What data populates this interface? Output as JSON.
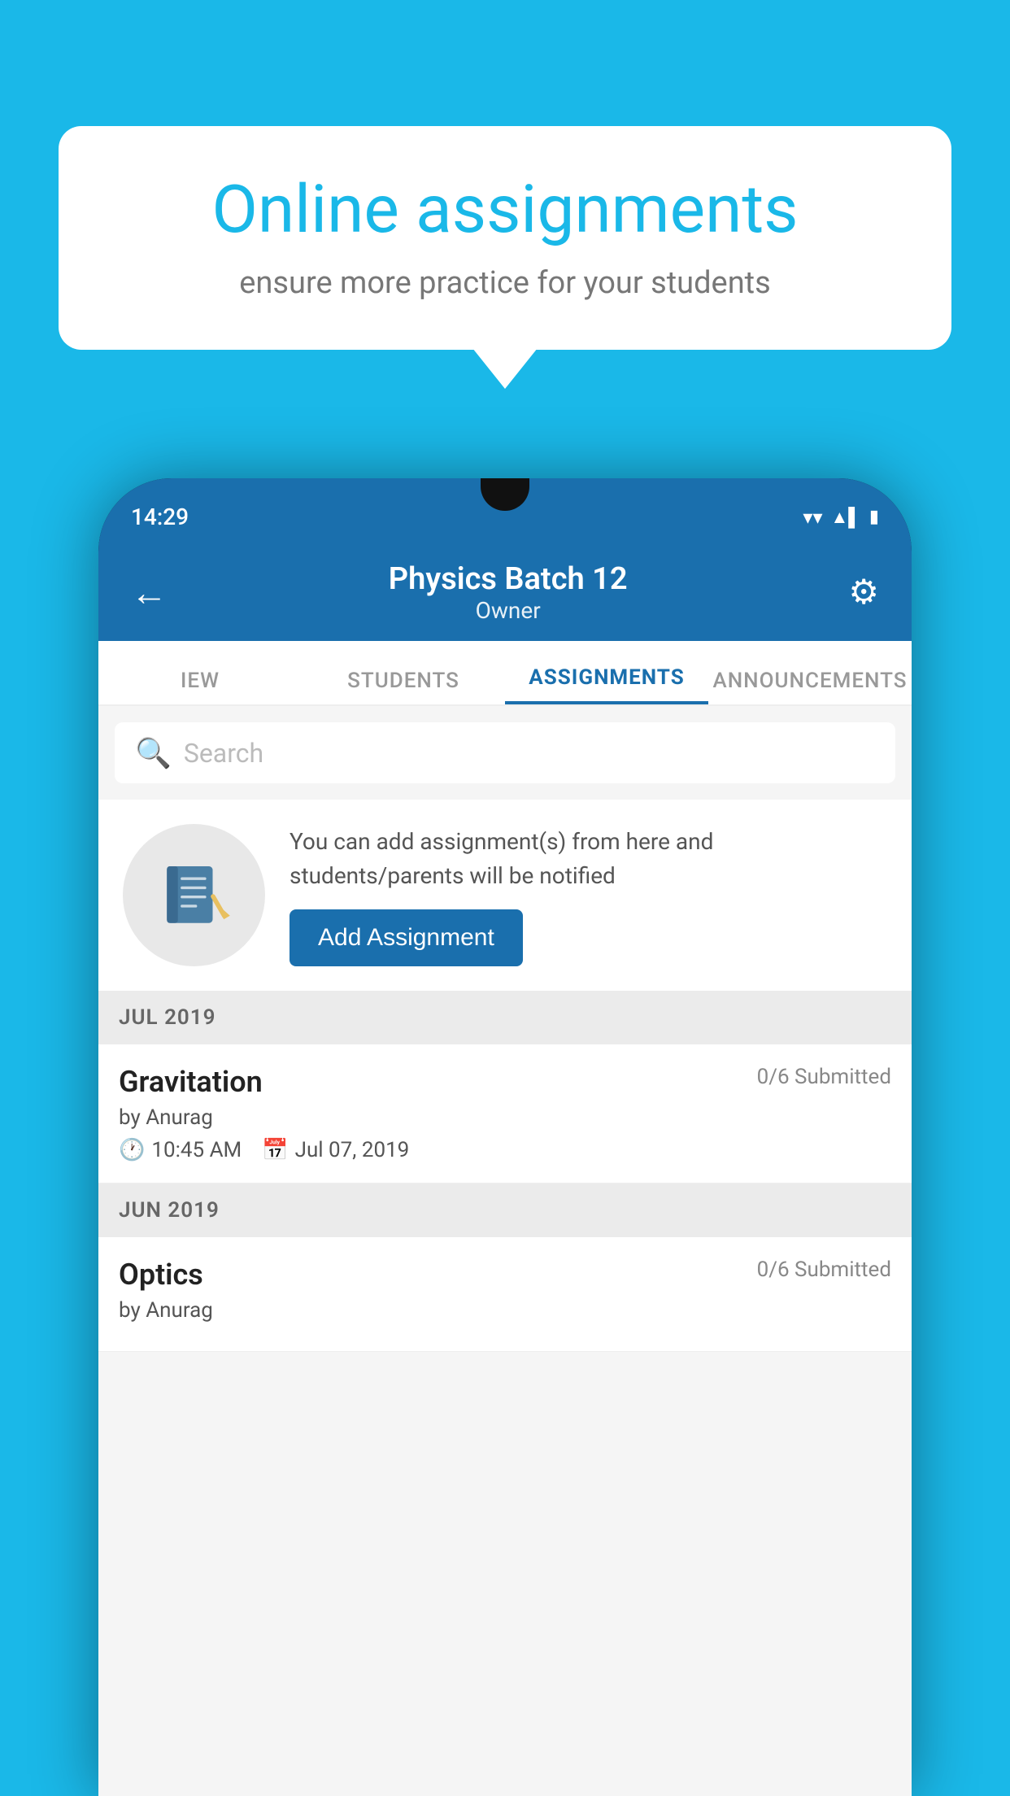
{
  "background_color": "#1ab8e8",
  "speech_bubble": {
    "heading": "Online assignments",
    "subtext": "ensure more practice for your students"
  },
  "phone": {
    "status_bar": {
      "time": "14:29"
    },
    "header": {
      "title": "Physics Batch 12",
      "subtitle": "Owner"
    },
    "tabs": [
      {
        "label": "IEW",
        "active": false
      },
      {
        "label": "STUDENTS",
        "active": false
      },
      {
        "label": "ASSIGNMENTS",
        "active": true
      },
      {
        "label": "ANNOUNCEMENTS",
        "active": false
      }
    ],
    "search": {
      "placeholder": "Search"
    },
    "promo": {
      "description": "You can add assignment(s) from here and students/parents will be notified",
      "button_label": "Add Assignment"
    },
    "sections": [
      {
        "label": "JUL 2019",
        "assignments": [
          {
            "title": "Gravitation",
            "submitted": "0/6 Submitted",
            "author": "by Anurag",
            "time": "10:45 AM",
            "date": "Jul 07, 2019"
          }
        ]
      },
      {
        "label": "JUN 2019",
        "assignments": [
          {
            "title": "Optics",
            "submitted": "0/6 Submitted",
            "author": "by Anurag",
            "time": "",
            "date": ""
          }
        ]
      }
    ]
  }
}
